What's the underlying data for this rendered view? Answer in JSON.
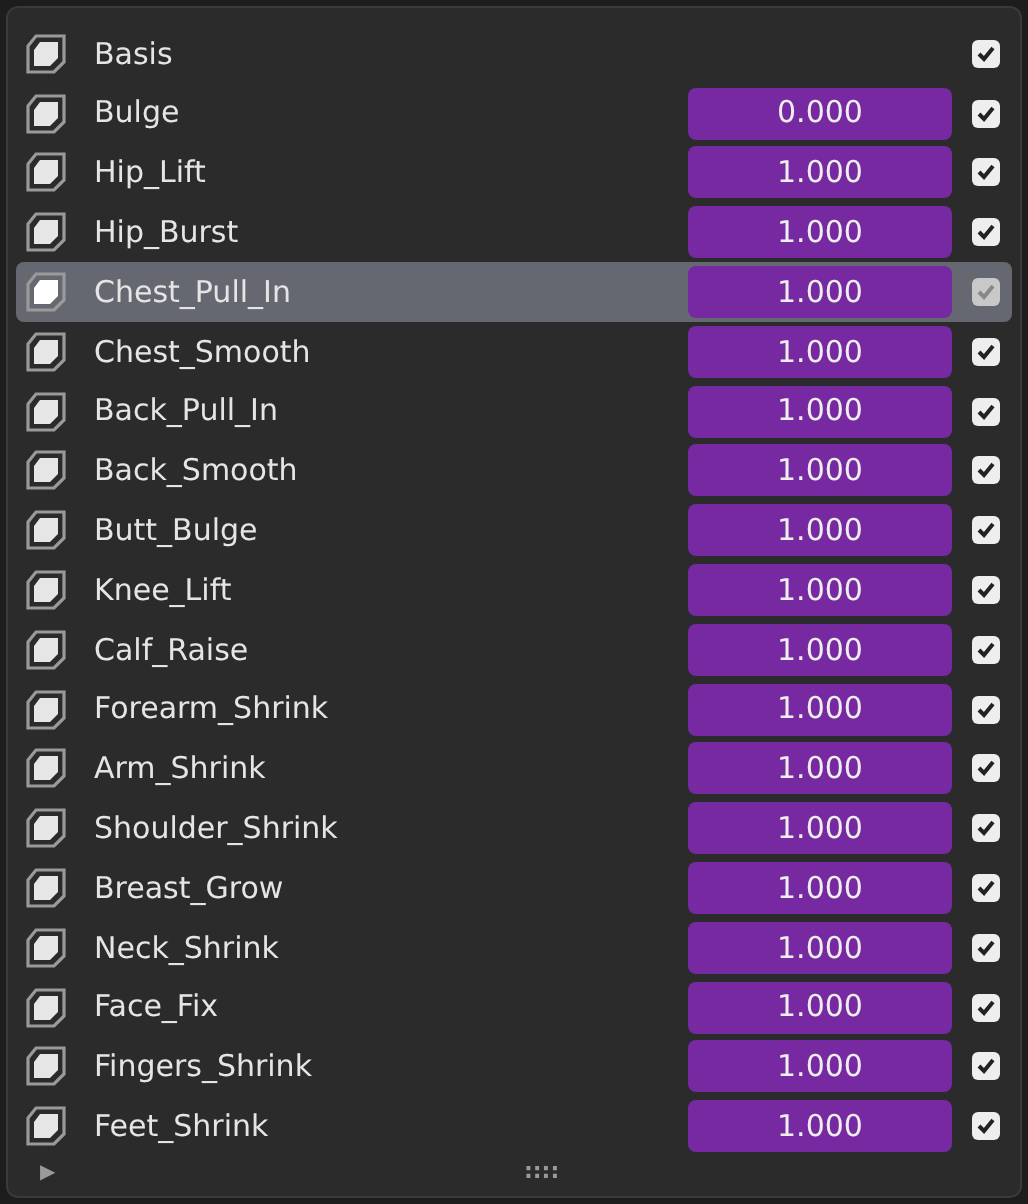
{
  "shape_keys": [
    {
      "name": "Basis",
      "kind": "basis",
      "selected": false,
      "checked": true
    },
    {
      "name": "Bulge",
      "kind": "key",
      "value": "0.000",
      "selected": false,
      "checked": true
    },
    {
      "name": "Hip_Lift",
      "kind": "key",
      "value": "1.000",
      "selected": false,
      "checked": true
    },
    {
      "name": "Hip_Burst",
      "kind": "key",
      "value": "1.000",
      "selected": false,
      "checked": true
    },
    {
      "name": "Chest_Pull_In",
      "kind": "key",
      "value": "1.000",
      "selected": true,
      "checked": true
    },
    {
      "name": "Chest_Smooth",
      "kind": "key",
      "value": "1.000",
      "selected": false,
      "checked": true
    },
    {
      "name": "Back_Pull_In",
      "kind": "key",
      "value": "1.000",
      "selected": false,
      "checked": true
    },
    {
      "name": "Back_Smooth",
      "kind": "key",
      "value": "1.000",
      "selected": false,
      "checked": true
    },
    {
      "name": "Butt_Bulge",
      "kind": "key",
      "value": "1.000",
      "selected": false,
      "checked": true
    },
    {
      "name": "Knee_Lift",
      "kind": "key",
      "value": "1.000",
      "selected": false,
      "checked": true
    },
    {
      "name": "Calf_Raise",
      "kind": "key",
      "value": "1.000",
      "selected": false,
      "checked": true
    },
    {
      "name": "Forearm_Shrink",
      "kind": "key",
      "value": "1.000",
      "selected": false,
      "checked": true
    },
    {
      "name": "Arm_Shrink",
      "kind": "key",
      "value": "1.000",
      "selected": false,
      "checked": true
    },
    {
      "name": "Shoulder_Shrink",
      "kind": "key",
      "value": "1.000",
      "selected": false,
      "checked": true
    },
    {
      "name": "Breast_Grow",
      "kind": "key",
      "value": "1.000",
      "selected": false,
      "checked": true
    },
    {
      "name": "Neck_Shrink",
      "kind": "key",
      "value": "1.000",
      "selected": false,
      "checked": true
    },
    {
      "name": "Face_Fix",
      "kind": "key",
      "value": "1.000",
      "selected": false,
      "checked": true
    },
    {
      "name": "Fingers_Shrink",
      "kind": "key",
      "value": "1.000",
      "selected": false,
      "checked": true
    },
    {
      "name": "Feet_Shrink",
      "kind": "key",
      "value": "1.000",
      "selected": false,
      "checked": true
    }
  ],
  "footer": {
    "expand_toggle": "▶",
    "resize_grip": "::::"
  }
}
